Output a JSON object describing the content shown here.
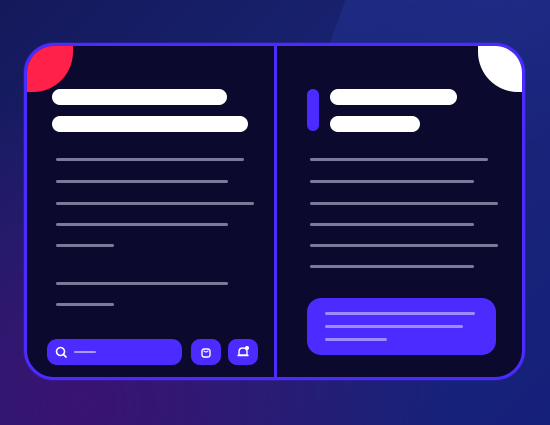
{
  "colors": {
    "accent": "#4b2bff",
    "panel": "#0b0a2e",
    "corner_left": "#ff2149",
    "corner_right": "#ffffff",
    "text_placeholder": "#7a7a99",
    "title_placeholder": "#ffffff"
  },
  "left_panel": {
    "title_placeholder_lines": 2,
    "body_placeholder_lines": 5,
    "extra_placeholder_lines": 2
  },
  "right_panel": {
    "title_placeholder_lines": 2,
    "body_placeholder_lines": 6,
    "action_button_placeholder_lines": 3
  },
  "bottom_bar": {
    "icons": [
      "search-icon",
      "shopping-bag-icon",
      "notification-bell-icon"
    ]
  }
}
